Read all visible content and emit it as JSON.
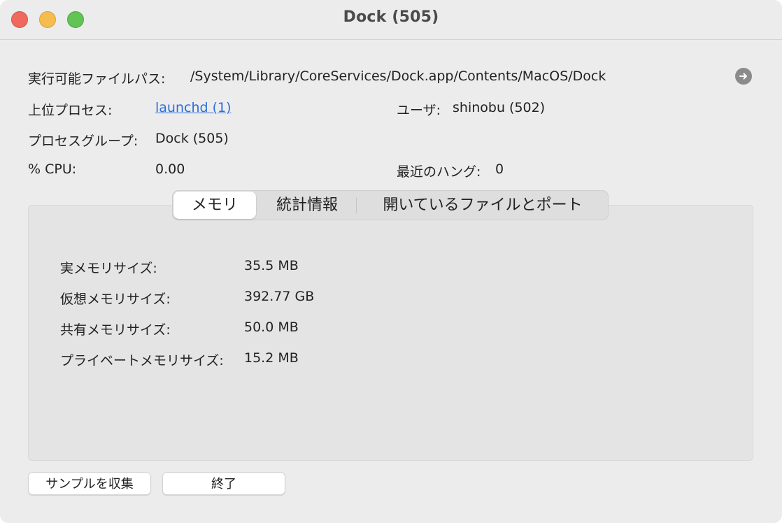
{
  "window": {
    "title": "Dock (505)"
  },
  "info": {
    "exec_path_label": "実行可能ファイルパス:",
    "exec_path_value": "/System/Library/CoreServices/Dock.app/Contents/MacOS/Dock",
    "parent_label": "上位プロセス:",
    "parent_value": "launchd (1)",
    "user_label": "ユーザ:",
    "user_value": "shinobu (502)",
    "group_label": "プロセスグループ:",
    "group_value": "Dock (505)",
    "cpu_label": "% CPU:",
    "cpu_value": "0.00",
    "hangs_label": "最近のハング:",
    "hangs_value": "0"
  },
  "tabs": [
    {
      "label": "メモリ",
      "active": true
    },
    {
      "label": "統計情報",
      "active": false
    },
    {
      "label": "開いているファイルとポート",
      "active": false
    }
  ],
  "memory": [
    {
      "label": "実メモリサイズ:",
      "value": "35.5 MB"
    },
    {
      "label": "仮想メモリサイズ:",
      "value": "392.77 GB"
    },
    {
      "label": "共有メモリサイズ:",
      "value": "50.0 MB"
    },
    {
      "label": "プライベートメモリサイズ:",
      "value": "15.2 MB"
    }
  ],
  "buttons": {
    "sample": "サンプルを収集",
    "quit": "終了"
  },
  "icons": {
    "reveal": "arrow-right-circle-icon"
  }
}
